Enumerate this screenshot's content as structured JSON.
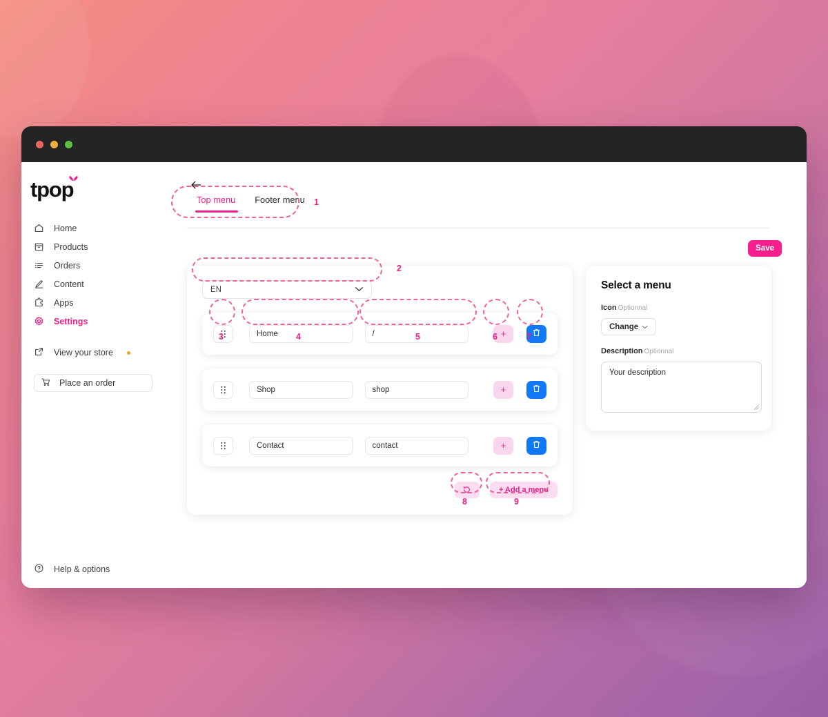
{
  "window": {
    "traffic_lights": [
      "close",
      "minimize",
      "maximize"
    ]
  },
  "brand": {
    "logo_text": "tpop"
  },
  "sidebar": {
    "items": [
      {
        "label": "Home",
        "icon": "home-icon",
        "active": false
      },
      {
        "label": "Products",
        "icon": "products-icon",
        "active": false
      },
      {
        "label": "Orders",
        "icon": "orders-icon",
        "active": false
      },
      {
        "label": "Content",
        "icon": "content-icon",
        "active": false
      },
      {
        "label": "Apps",
        "icon": "apps-icon",
        "active": false
      },
      {
        "label": "Settings",
        "icon": "settings-icon",
        "active": true
      }
    ],
    "view_store": {
      "label": "View your store",
      "icon": "external-link-icon",
      "has_dot": true
    },
    "place_order": {
      "label": "Place an order",
      "icon": "cart-icon"
    },
    "help": {
      "label": "Help & options",
      "icon": "question-circle-icon"
    }
  },
  "header": {
    "back_icon": "arrow-left-icon",
    "tabs": [
      {
        "label": "Top menu",
        "active": true
      },
      {
        "label": "Footer menu",
        "active": false
      }
    ],
    "save_label": "Save"
  },
  "menu_editor": {
    "language_select": {
      "value": "EN",
      "chevron": "chevron-down-icon"
    },
    "rows": [
      {
        "handle": "drag-handle-icon",
        "label": "Home",
        "path": "/",
        "add_label": "+",
        "delete_icon": "trash-icon"
      },
      {
        "handle": "drag-handle-icon",
        "label": "Shop",
        "path": "shop",
        "add_label": "+",
        "delete_icon": "trash-icon"
      },
      {
        "handle": "drag-handle-icon",
        "label": "Contact",
        "path": "contact",
        "add_label": "+",
        "delete_icon": "trash-icon"
      }
    ],
    "restore_button": {
      "icon": "restore-icon"
    },
    "add_menu_label": "+ Add a menu"
  },
  "detail_panel": {
    "title": "Select a menu",
    "icon_label": "Icon",
    "icon_optional": "Optionnal",
    "change_label": "Change",
    "change_chevron": "chevron-down-icon",
    "description_label": "Description",
    "description_optional": "Optionnal",
    "description_value": "Your description"
  },
  "annotations": [
    {
      "n": "1",
      "target": "tabs"
    },
    {
      "n": "2",
      "target": "language-select"
    },
    {
      "n": "3",
      "target": "drag-handle"
    },
    {
      "n": "4",
      "target": "label-field"
    },
    {
      "n": "5",
      "target": "path-field"
    },
    {
      "n": "6",
      "target": "add-sub-button"
    },
    {
      "n": "7",
      "target": "delete-button"
    },
    {
      "n": "8",
      "target": "restore-button"
    },
    {
      "n": "9",
      "target": "add-menu-button"
    }
  ],
  "colors": {
    "accent_pink": "#ee1d87",
    "save_pink": "#f71e8e",
    "soft_pink": "#fbdcf1",
    "blue": "#1179f5",
    "annotation": "#f0609a"
  }
}
